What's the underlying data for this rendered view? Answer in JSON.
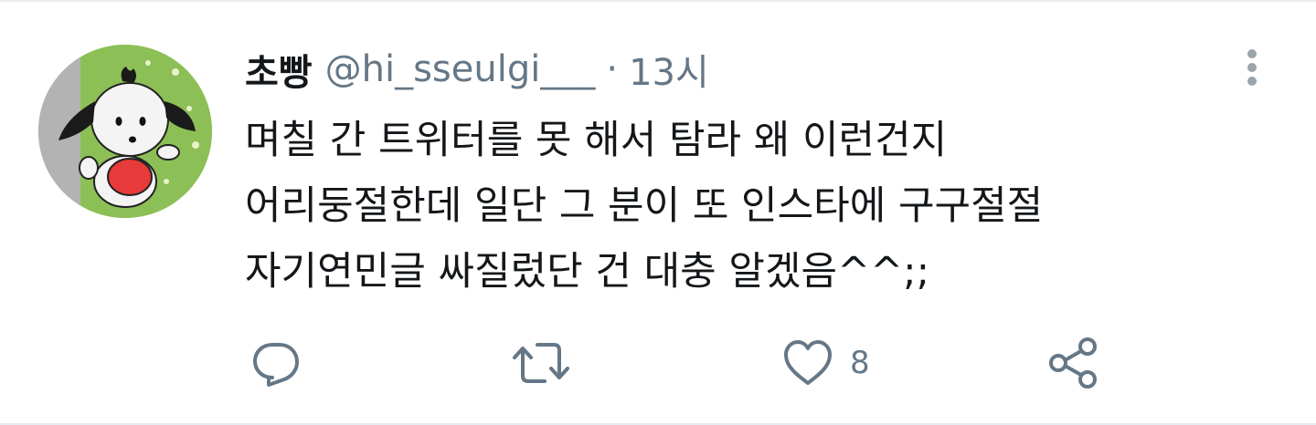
{
  "tweet": {
    "author": {
      "display_name": "초빵",
      "handle": "@hi_sseulgi___",
      "separator": "·",
      "time": "13시",
      "avatar_icon": "puppy-character-avatar"
    },
    "text_lines": [
      "며칠 간 트위터를 못 해서 탐라 왜 이런건지",
      "어리둥절한데 일단 그 분이 또 인스타에 구구절절",
      "자기연민글 싸질렀단 건 대충 알겠음^^;;"
    ],
    "actions": {
      "reply": {
        "icon": "reply-icon"
      },
      "retweet": {
        "icon": "retweet-icon"
      },
      "like": {
        "icon": "heart-icon",
        "count": "8"
      },
      "share": {
        "icon": "share-icon"
      }
    },
    "menu_icon": "more-vertical-icon"
  },
  "colors": {
    "text": "#14171a",
    "secondary": "#657786",
    "divider": "#e6ecf0"
  }
}
